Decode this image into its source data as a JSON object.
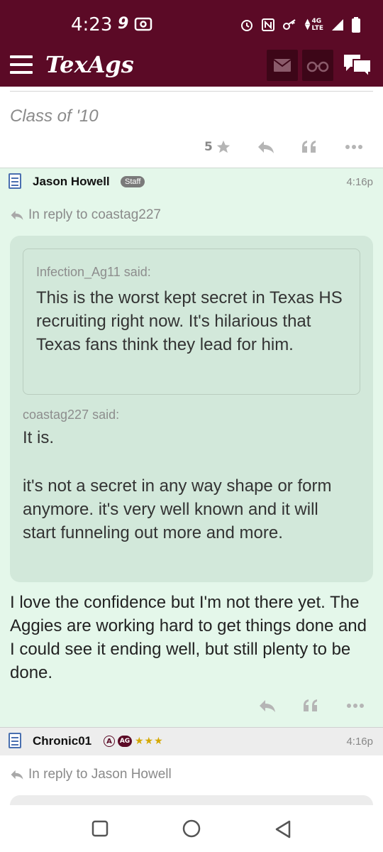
{
  "status_bar": {
    "time": "4:23",
    "left_icons": [
      "nine-icon",
      "radio-icon"
    ],
    "right_icons": [
      "alarm-icon",
      "nfc-icon",
      "key-icon",
      "data-arrows-icon",
      "4g-lte-icon",
      "signal-icon",
      "battery-icon"
    ],
    "network_label_top": "4G",
    "network_label_bottom": "LTE"
  },
  "app_bar": {
    "logo": "TexAgs",
    "menu_icon": "hamburger-menu-icon",
    "mail_icon": "envelope-icon",
    "binoculars_icon": "binoculars-icon",
    "chat_icon": "chat-bubbles-icon",
    "colors": {
      "brand": "#5b0a26",
      "button_bg": "#3d0618"
    }
  },
  "previous_post": {
    "signature": "Class of '10",
    "star_count": "5"
  },
  "posts": [
    {
      "username": "Jason Howell",
      "badge": "Staff",
      "time": "4:16p",
      "reply_to": "In reply to coastag227",
      "quotes": [
        {
          "said": "Infection_Ag11 said:",
          "text": "This is the worst kept secret in Texas HS recruiting right now. It's hilarious that Texas fans think they lead for him."
        },
        {
          "said": "coastag227 said:",
          "text_lines": [
            "It is.",
            "",
            "it's not a secret in any way shape or form anymore. it's very well known and it will start funneling out more and more."
          ]
        }
      ],
      "body": "I love the confidence but I'm not there yet. The Aggies are working hard to get things done and I could see it ending well, but still plenty to be done.",
      "bg_color": "#e4f7ea"
    },
    {
      "username": "Chronic01",
      "badge_a": "A",
      "badge_ag": "AG",
      "stars": "★★★",
      "time": "4:16p",
      "reply_to": "In reply to Jason Howell"
    }
  ],
  "nav_bar": {
    "recents_icon": "square-recents-icon",
    "home_icon": "circle-home-icon",
    "back_icon": "triangle-back-icon"
  }
}
